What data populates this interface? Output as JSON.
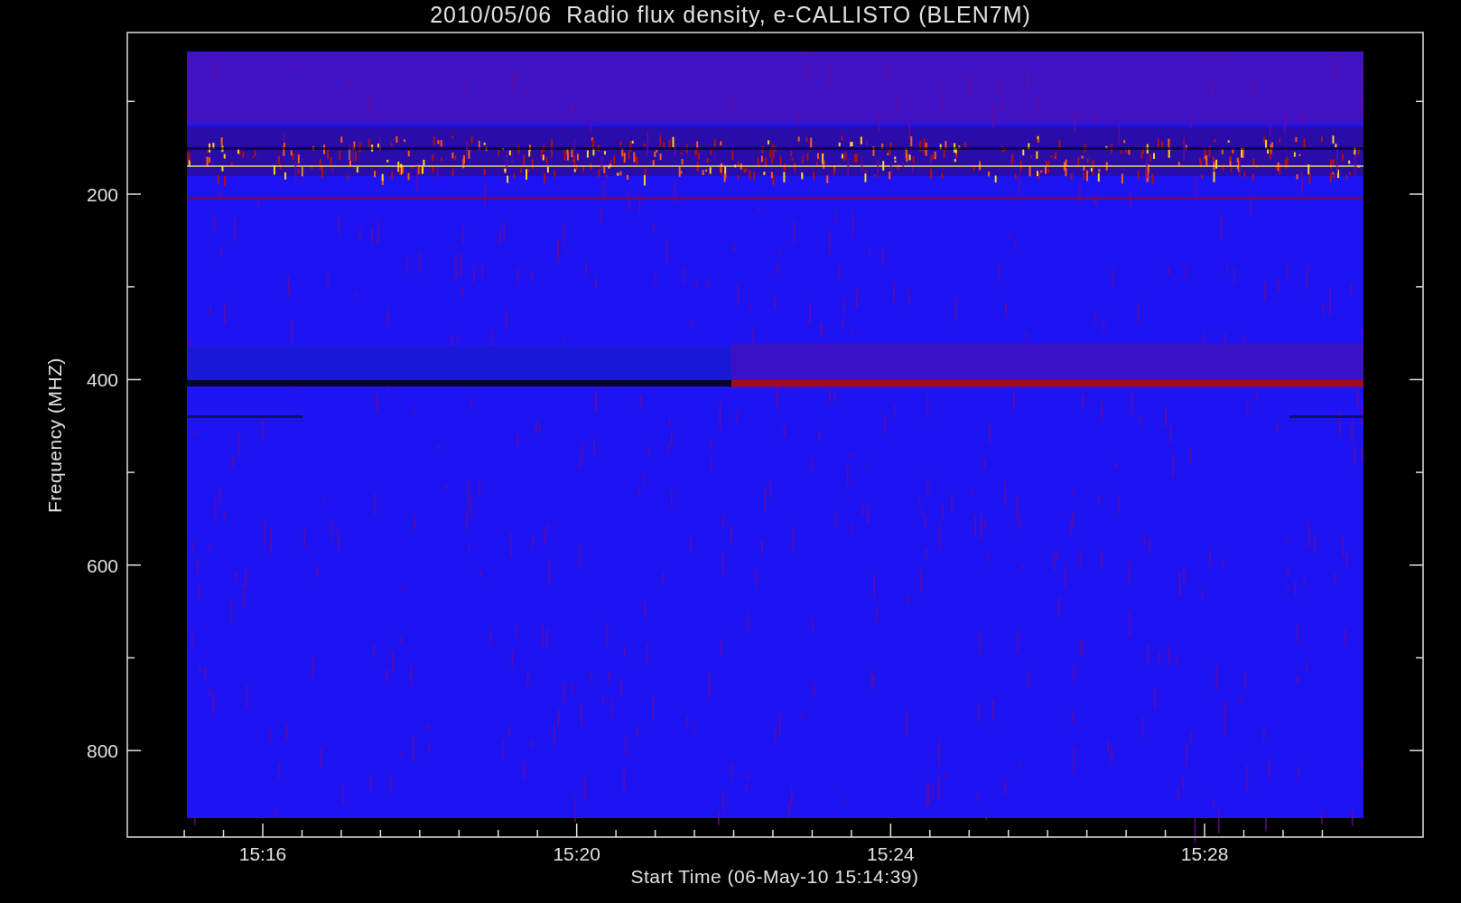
{
  "title": "2010/05/06  Radio flux density, e-CALLISTO (BLEN7M)",
  "y_axis": {
    "label": "Frequency (MHZ)",
    "ticks": [
      "200",
      "400",
      "600",
      "800"
    ]
  },
  "x_axis": {
    "label": "Start Time (06-May-10 15:14:39)",
    "ticks": [
      "15:16",
      "15:20",
      "15:24",
      "15:28"
    ]
  }
}
